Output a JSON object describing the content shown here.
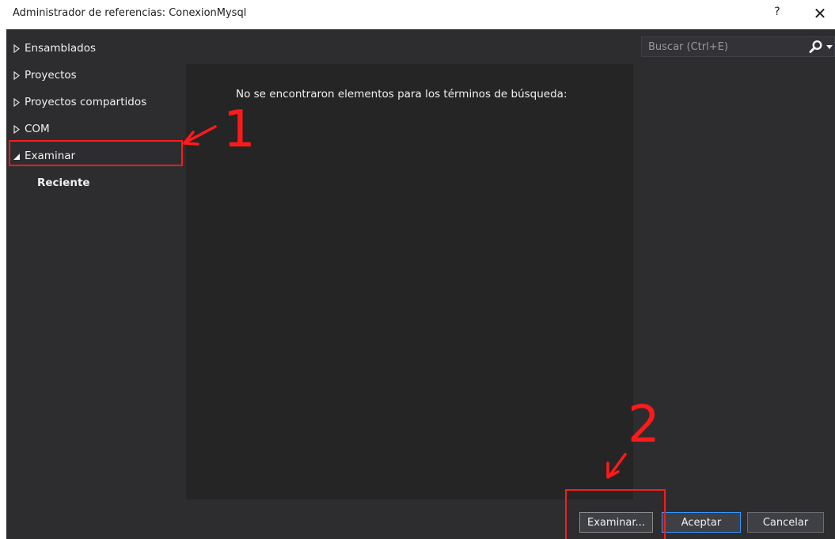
{
  "window": {
    "title": "Administrador de referencias: ConexionMysql",
    "help_label": "?",
    "close_label": "✕"
  },
  "nav": {
    "items": [
      {
        "label": "Ensamblados",
        "expanded": false
      },
      {
        "label": "Proyectos",
        "expanded": false
      },
      {
        "label": "Proyectos compartidos",
        "expanded": false
      },
      {
        "label": "COM",
        "expanded": false
      },
      {
        "label": "Examinar",
        "expanded": true
      }
    ],
    "sub_items": [
      {
        "label": "Reciente"
      }
    ]
  },
  "main": {
    "empty_message": "No se encontraron elementos para los términos de búsqueda:"
  },
  "search": {
    "placeholder": "Buscar (Ctrl+E)",
    "value": "",
    "icon": "search-icon"
  },
  "footer": {
    "browse_label": "Examinar...",
    "ok_label": "Aceptar",
    "cancel_label": "Cancelar"
  },
  "annotations": {
    "step1": "1",
    "step2": "2",
    "color": "#ff1a1a"
  },
  "colors": {
    "dialog_bg": "#2d2d30",
    "list_bg": "#252526",
    "text": "#f1f1f1",
    "accent": "#3399ff"
  }
}
